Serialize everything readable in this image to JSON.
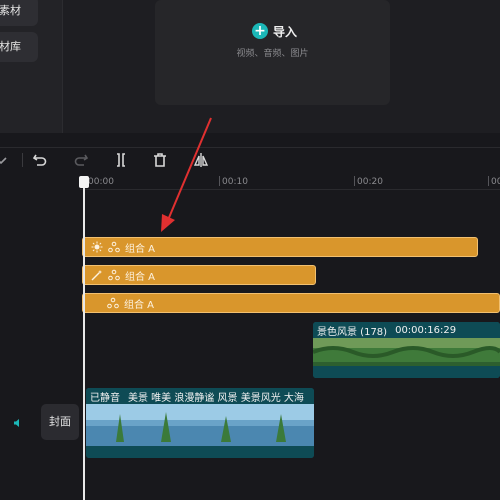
{
  "sidebar": {
    "items": [
      {
        "label": "云素材"
      },
      {
        "label": "素材库"
      }
    ]
  },
  "import_panel": {
    "button_label": "导入",
    "hint": "视频、音频、图片"
  },
  "ruler": {
    "ticks": [
      "00:00",
      "00:10",
      "00:20",
      "00"
    ]
  },
  "tracks": {
    "audio": [
      {
        "label": "组合 A"
      },
      {
        "label": "组合 A"
      },
      {
        "label": "组合 A"
      }
    ],
    "video": [
      {
        "label": "景色风景 (178)",
        "duration": "00:00:16:29"
      },
      {
        "label": "已静音",
        "caption": "美景 唯美 浪漫静谧 风景 美景风光 大海"
      }
    ]
  },
  "cover_label": "封面",
  "colors": {
    "accent": "#1bb7b7",
    "audio_clip": "#d9962c",
    "video_clip": "#0f5a66",
    "arrow": "#e03030"
  },
  "icons": [
    "plus-icon",
    "undo-icon",
    "redo-icon",
    "split-icon",
    "delete-icon",
    "mirror-icon",
    "speaker-icon"
  ]
}
